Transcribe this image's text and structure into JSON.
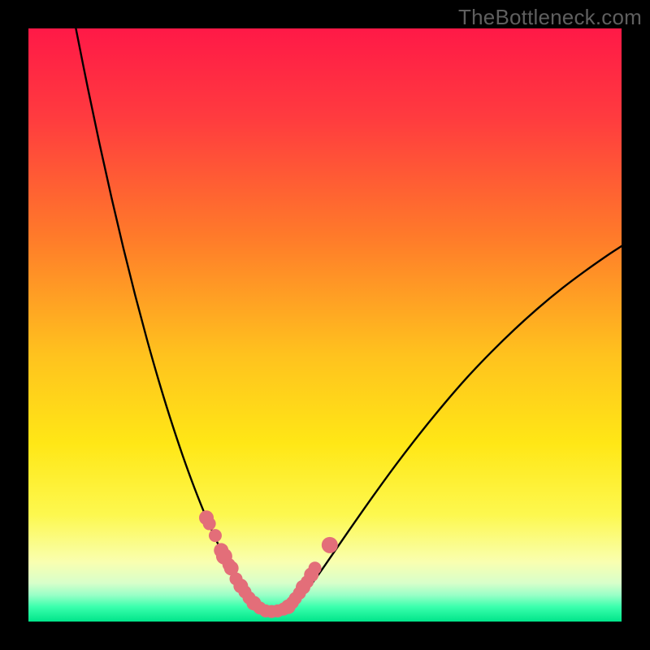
{
  "watermark": {
    "text": "TheBottleneck.com"
  },
  "colors": {
    "background": "#000000",
    "curve_stroke": "#000000",
    "marker_fill": "#e36e79",
    "gradient_stops": [
      {
        "offset": 0.0,
        "color": "#ff1947"
      },
      {
        "offset": 0.15,
        "color": "#ff3b3f"
      },
      {
        "offset": 0.35,
        "color": "#ff7a2a"
      },
      {
        "offset": 0.55,
        "color": "#ffc21e"
      },
      {
        "offset": 0.7,
        "color": "#ffe716"
      },
      {
        "offset": 0.82,
        "color": "#fdf84f"
      },
      {
        "offset": 0.9,
        "color": "#f9ffb0"
      },
      {
        "offset": 0.935,
        "color": "#d8ffca"
      },
      {
        "offset": 0.955,
        "color": "#9affc7"
      },
      {
        "offset": 0.975,
        "color": "#3bffad"
      },
      {
        "offset": 1.0,
        "color": "#00e58a"
      }
    ]
  },
  "chart_data": {
    "type": "line",
    "title": "",
    "xlabel": "",
    "ylabel": "",
    "x_range": [
      0,
      100
    ],
    "y_range": [
      0,
      100
    ],
    "series": [
      {
        "name": "bottleneck-curve",
        "x": [
          8,
          10,
          12,
          14,
          16,
          18,
          20,
          22,
          24,
          26,
          28,
          30,
          32,
          34,
          35,
          36,
          37,
          38,
          39,
          40,
          41,
          42,
          44,
          46,
          48,
          50,
          54,
          58,
          62,
          66,
          70,
          74,
          78,
          82,
          86,
          90,
          94,
          98,
          100
        ],
        "y": [
          100,
          90,
          80.5,
          71.5,
          63,
          55,
          47.5,
          40.5,
          34,
          28,
          22.5,
          17.5,
          13,
          9,
          7.2,
          5.6,
          4.2,
          3.1,
          2.3,
          1.8,
          1.7,
          1.8,
          2.6,
          4.3,
          6.7,
          9.5,
          15.3,
          21,
          26.5,
          31.7,
          36.6,
          41.2,
          45.4,
          49.3,
          52.9,
          56.2,
          59.2,
          62.0,
          63.3
        ]
      }
    ],
    "markers": {
      "name": "highlighted-points",
      "x": [
        30.0,
        30.5,
        31.5,
        32.5,
        33.0,
        33.8,
        34.2,
        35.0,
        35.8,
        36.5,
        37.2,
        38.0,
        39.0,
        40.0,
        41.0,
        42.0,
        43.0,
        43.8,
        44.5,
        45.0,
        45.7,
        46.3,
        47.0,
        47.7,
        48.3,
        50.8
      ],
      "y": [
        17.5,
        16.5,
        14.5,
        12.0,
        11.0,
        9.6,
        9.0,
        7.2,
        6.0,
        5.0,
        4.0,
        3.1,
        2.3,
        1.8,
        1.7,
        1.8,
        2.1,
        2.5,
        3.2,
        3.9,
        4.8,
        5.8,
        6.7,
        7.9,
        9.0,
        12.9
      ],
      "r": [
        9,
        8,
        8,
        9,
        10,
        8,
        9,
        8,
        9,
        8,
        8,
        9,
        8,
        8,
        8,
        8,
        8,
        9,
        8,
        8,
        8,
        9,
        8,
        9,
        8,
        10
      ]
    }
  }
}
